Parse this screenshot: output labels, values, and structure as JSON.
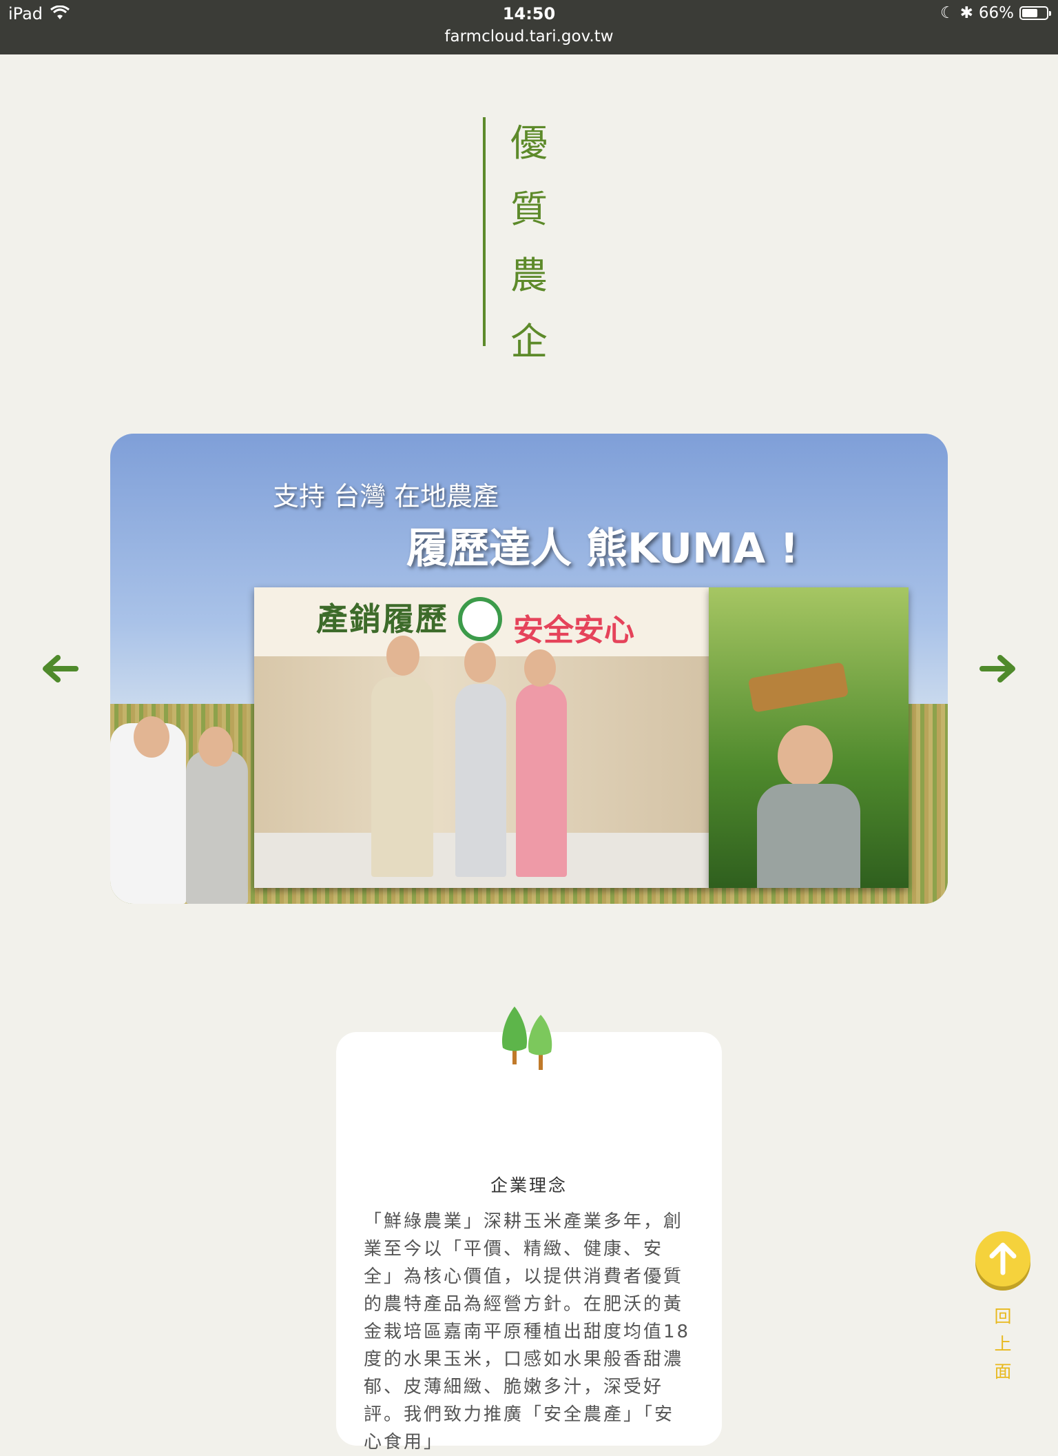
{
  "status_bar": {
    "device": "iPad",
    "time": "14:50",
    "url": "farmcloud.tari.gov.tw",
    "battery": "66%",
    "battery_level": 0.66
  },
  "section_title": [
    "優",
    "質",
    "農",
    "企"
  ],
  "banner": {
    "subtitle": "支持 台灣 在地農產",
    "headline": "履歷達人 熊KUMA !",
    "event_title_left": "產銷履歷",
    "event_title_right": "安全安心"
  },
  "card": {
    "title": "企業理念",
    "body": "「鮮綠農業」深耕玉米產業多年，創業至今以「平價、精緻、健康、安全」為核心價值，以提供消費者優質的農特產品為經營方針。在肥沃的黃金栽培區嘉南平原種植出甜度均值18度的水果玉米，口感如水果般香甜濃郁、皮薄細緻、脆嫩多汁，深受好評。我們致力推廣「安全農產」「安心食用」"
  },
  "back_to_top": {
    "label": [
      "回",
      "上",
      "面"
    ]
  },
  "colors": {
    "accent_green": "#5d8a2a",
    "arrow_green": "#4f8a2b",
    "yellow": "#f5d23c",
    "background": "#f2f1eb"
  }
}
